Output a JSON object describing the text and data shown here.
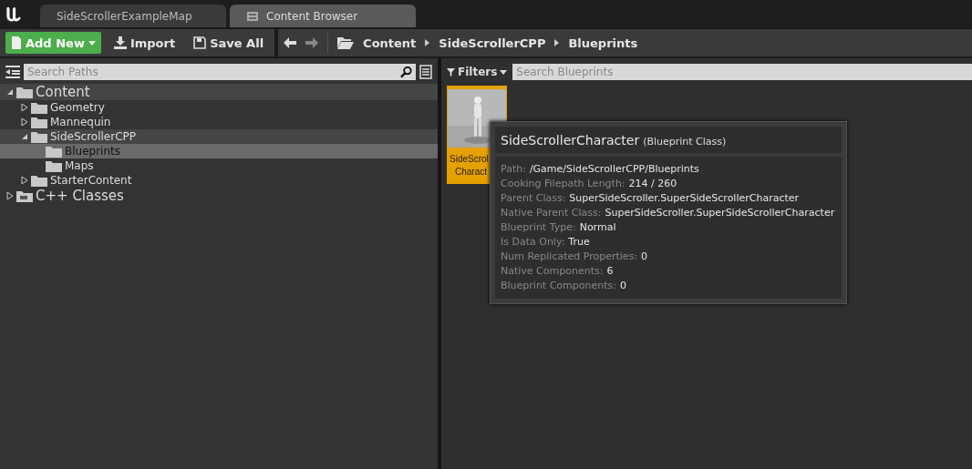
{
  "tabs": [
    {
      "label": "SideScrollerExampleMap",
      "selected": false
    },
    {
      "label": "Content Browser",
      "selected": true
    }
  ],
  "toolbar": {
    "add_new": "Add New",
    "import": "Import",
    "save_all": "Save All"
  },
  "breadcrumbs": [
    "Content",
    "SideScrollerCPP",
    "Blueprints"
  ],
  "sources": {
    "search": {
      "placeholder": "Search Paths"
    },
    "tree": [
      {
        "label": "Content",
        "expanded": true,
        "selected": false,
        "children": [
          {
            "label": "Geometry",
            "expanded": false,
            "selected": false
          },
          {
            "label": "Mannequin",
            "expanded": false,
            "selected": false
          },
          {
            "label": "SideScrollerCPP",
            "expanded": true,
            "selected": false,
            "children": [
              {
                "label": "Blueprints",
                "selected": true
              },
              {
                "label": "Maps",
                "selected": false
              }
            ]
          },
          {
            "label": "StarterContent",
            "expanded": false,
            "selected": false
          }
        ]
      },
      {
        "label": "C++ Classes",
        "expanded": false,
        "selected": false,
        "kind": "code"
      }
    ]
  },
  "assets": {
    "filters": "Filters",
    "search": {
      "placeholder": "Search Blueprints"
    },
    "items": [
      {
        "label_lines": [
          "SideScrol",
          "Charact"
        ],
        "selected": true
      }
    ]
  },
  "tooltip": {
    "title": "SideScrollerCharacter",
    "subtitle": "(Blueprint Class)",
    "rows": [
      {
        "label": "Path:",
        "value": "/Game/SideScrollerCPP/Blueprints"
      },
      {
        "label": "Cooking Filepath Length:",
        "value": "214 / 260"
      },
      {
        "label": "Parent Class:",
        "value": "SuperSideScroller.SuperSideScrollerCharacter"
      },
      {
        "label": "Native Parent Class:",
        "value": "SuperSideScroller.SuperSideScrollerCharacter"
      },
      {
        "label": "Blueprint Type:",
        "value": "Normal"
      },
      {
        "label": "Is Data Only:",
        "value": "True"
      },
      {
        "label": "Num Replicated Properties:",
        "value": "0"
      },
      {
        "label": "Native Components:",
        "value": "6"
      },
      {
        "label": "Blueprint Components:",
        "value": "0"
      }
    ]
  }
}
